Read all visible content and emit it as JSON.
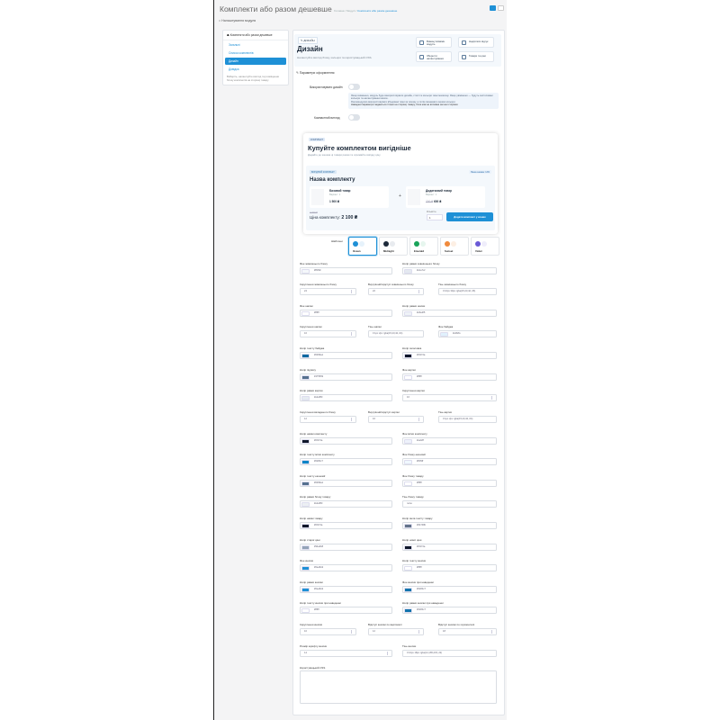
{
  "header": {
    "title": "Комплекти або разом дешевше",
    "bc1": "Головна",
    "bc_sep": "/",
    "bc2": "Модулі",
    "bc3": "Комплекти або разом дешевше"
  },
  "subbar": {
    "label": "Налаштування модуля"
  },
  "colors": {
    "accent": "#1e90d6",
    "dark": "#1d2a3a"
  },
  "sidebar": {
    "header": "Комплекти або разом дешевше",
    "items": [
      {
        "label": "Загальні",
        "active": false
      },
      {
        "label": "Список комплектів",
        "active": false
      },
      {
        "label": "Дизайн",
        "active": true
      },
      {
        "label": "Довідка",
        "active": false
      }
    ],
    "note": "Виберіть, налаштуйте вигляд та розміщення блоку комплектів на сторінці товару"
  },
  "hero": {
    "badge": "ДИЗАЙН",
    "title": "Дизайн",
    "subtitle": "Налаштуйте вигляд блоку, кольори та користувацький CSS.",
    "buttons": [
      "Вимкнути/ввімк. модуль",
      "Надіслати відгук",
      "Зберегти налаштування",
      "Товари та ціни"
    ]
  },
  "section": {
    "title": "Параметри оформлення"
  },
  "toggles": [
    {
      "label": "Використовувати дизайн",
      "on": false
    },
    {
      "label": "Компактний вигляд",
      "on": false
    }
  ],
  "info": {
    "line1": "Якщо вимкнено, модуль буде використовувати дизайн, стилі та кольори теми магазину. Якщо увімкнено — будуть застосовані кольори та налаштування нижче.",
    "line2": "Рекомендуємо використовувати вбудовані теми як основу, а потім змінювати окремі кольори.",
    "line3": "Наведені параметри задаються тільки на сторінці товару, блок ніяк не впливає на інші сторінки."
  },
  "preview": {
    "badge": "КОМПЛЕКТ",
    "title": "Купуйте комплектом вигідніше",
    "subtitle": "Додайте до кошика ці товари разом та отримайте вигідну ціну.",
    "tag": "ВИГІДНИЙ КОМПЛЕКТ",
    "save": "Ваша знижка: 13%",
    "name": "Назва комплекту",
    "products": [
      {
        "name": "Базовий товар",
        "variant": "Варіант: 1",
        "price": "1 500 ₴",
        "old": ""
      },
      {
        "name": "Додатковий товар",
        "variant": "Варіант: 1",
        "price": "600 ₴",
        "old": "700 ₴"
      }
    ],
    "plus": "+",
    "old_total": "2 400 ₴",
    "total_label": "Ціна комплекту:",
    "total": "2 100 ₴",
    "qty_label": "Кількість:",
    "qty": "1",
    "add": "Додати комплект у кошик"
  },
  "themes": {
    "label": "Шаблони",
    "items": [
      {
        "name": "Ocean",
        "c1": "#1e90d6",
        "c2": "#e6f2fb",
        "selected": true
      },
      {
        "name": "Midnight",
        "c1": "#1d2a3a",
        "c2": "#e8ebef",
        "selected": false
      },
      {
        "name": "Emerald",
        "c1": "#1aa35a",
        "c2": "#e6f6ee",
        "selected": false
      },
      {
        "name": "Sunset",
        "c1": "#f08a3c",
        "c2": "#fdefe3",
        "selected": false
      },
      {
        "name": "Violet",
        "c1": "#6a5ad6",
        "c2": "#efedfb",
        "selected": false
      }
    ]
  },
  "fields": [
    {
      "label": "Фон зовнішнього блоку",
      "value": "#f6f9fc",
      "swatch": "#f5f8fb",
      "type": "color"
    },
    {
      "label": "Колір рамки зовнішнього блоку",
      "value": "#e1e7ef",
      "swatch": "#e4e9f0",
      "type": "color"
    },
    {
      "label": "Скруглення зовнішнього блоку",
      "value": "24",
      "type": "spin"
    },
    {
      "label": "Внутрішній відступ зовнішнього блоку",
      "value": "22",
      "type": "spin"
    },
    {
      "label": "Тінь зовнішнього блоку",
      "value": "0 10px 30px rgba(15,23,42,.06)",
      "type": "text"
    },
    {
      "label": "Фон шапки",
      "value": "#ffffff",
      "swatch": "#ffffff",
      "type": "color"
    },
    {
      "label": "Колір рамки шапки",
      "value": "#e6edf5",
      "swatch": "#eef2f7",
      "type": "color"
    },
    {
      "label": "Скруглення шапки",
      "value": "16",
      "type": "spin"
    },
    {
      "label": "Тінь шапки",
      "value": "0 1px 2px rgba(15,23,42,.04)",
      "type": "text"
    },
    {
      "label": "Фон бейджа",
      "value": "#e0f2fe",
      "swatch": "#e0f1fc",
      "type": "color"
    },
    {
      "label": "Колір тексту бейджа",
      "value": "#0369a1",
      "swatch": "#0369a1",
      "type": "color"
    },
    {
      "label": "Колір заголовка",
      "value": "#0f172a",
      "swatch": "#0f172a",
      "type": "color"
    },
    {
      "label": "Колір підпису",
      "value": "#475569",
      "swatch": "#55708f",
      "type": "color"
    },
    {
      "label": "Фон картки",
      "value": "#ffffff",
      "swatch": "#ffffff",
      "type": "color"
    },
    {
      "label": "Колір рамки картки",
      "value": "#e2e8f0",
      "swatch": "#e6ebf1",
      "type": "color"
    },
    {
      "label": "Скруглення картки",
      "value": "16",
      "type": "spin"
    },
    {
      "label": "Скруглення вкладеного блоку",
      "value": "12",
      "type": "spin"
    },
    {
      "label": "Внутрішній відступ картки",
      "value": "16",
      "type": "spin"
    },
    {
      "label": "Тінь картки",
      "value": "0 1px 2px rgba(15,23,42,.04)",
      "type": "text"
    },
    {
      "label": "Колір назви комплекту",
      "value": "#0f172a",
      "swatch": "#0f172a",
      "type": "color"
    },
    {
      "label": "Фон мітки комплекту",
      "value": "#eef2ff",
      "swatch": "#eef2fb",
      "type": "color"
    },
    {
      "label": "Колір тексту мітки комплекту",
      "value": "#0284c7",
      "swatch": "#0284c7",
      "type": "color"
    },
    {
      "label": "Фон блоку економії",
      "value": "#f0f9ff",
      "swatch": "#f0f8fe",
      "type": "color"
    },
    {
      "label": "Колір тексту економії",
      "value": "#0369a1",
      "swatch": "#55708f",
      "type": "color"
    },
    {
      "label": "Фон блоку товару",
      "value": "#ffffff",
      "swatch": "#ffffff",
      "type": "color"
    },
    {
      "label": "Колір рамки блоку товару",
      "value": "#e2e8f0",
      "swatch": "#eceff3",
      "type": "color"
    },
    {
      "label": "Тінь блоку товару",
      "value": "none",
      "type": "text"
    },
    {
      "label": "Колір назви товару",
      "value": "#0f172a",
      "swatch": "#0f172a",
      "type": "color"
    },
    {
      "label": "Колір мета тексту товару",
      "value": "#64748b",
      "swatch": "#64748b",
      "type": "color"
    },
    {
      "label": "Колір старої ціни",
      "value": "#94a3b8",
      "swatch": "#94a3b8",
      "type": "color"
    },
    {
      "label": "Колір нової ціни",
      "value": "#0f172a",
      "swatch": "#0f172a",
      "type": "color"
    },
    {
      "label": "Фон кнопки",
      "value": "#0ea5e9",
      "swatch": "#1e90d6",
      "type": "color"
    },
    {
      "label": "Колір тексту кнопки",
      "value": "#ffffff",
      "swatch": "#ffffff",
      "type": "color"
    },
    {
      "label": "Колір рамки кнопки",
      "value": "#0ea5e9",
      "swatch": "#1e90d6",
      "type": "color"
    },
    {
      "label": "Фон кнопки при наведенні",
      "value": "#0284c7",
      "swatch": "#1274ad",
      "type": "color"
    },
    {
      "label": "Колір тексту кнопки при наведенні",
      "value": "#ffffff",
      "swatch": "#ffffff",
      "type": "color"
    },
    {
      "label": "Колір рамки кнопки при наведенні",
      "value": "#0284c7",
      "swatch": "#1274ad",
      "type": "color"
    },
    {
      "label": "Скруглення кнопки",
      "value": "10",
      "type": "spin"
    },
    {
      "label": "Відступ кнопки по вертикалі",
      "value": "12",
      "type": "spin"
    },
    {
      "label": "Відступ кнопки по горизонталі",
      "value": "18",
      "type": "spin"
    },
    {
      "label": "Розмір шрифту кнопки",
      "value": "14",
      "type": "spin"
    },
    {
      "label": "Тінь кнопки",
      "value": "0 10px 18px rgba(14,165,233,.22)",
      "type": "text"
    }
  ],
  "css": {
    "label": "Користувацький CSS",
    "value": ""
  }
}
